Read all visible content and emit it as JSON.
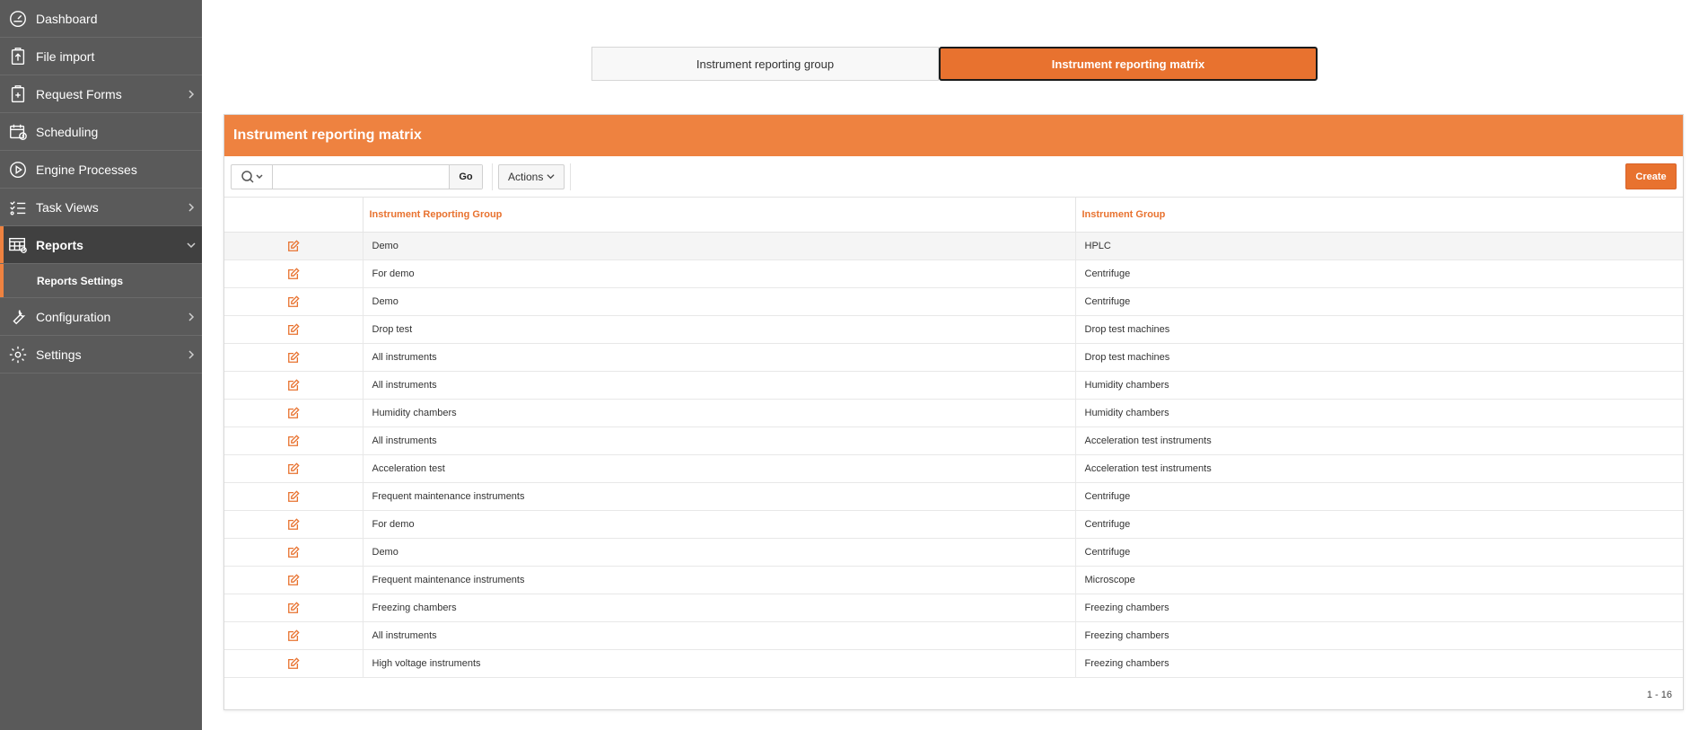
{
  "sidebar": {
    "items": [
      {
        "label": "Dashboard",
        "icon": "dashboard-icon",
        "chevron": false
      },
      {
        "label": "File import",
        "icon": "file-import-icon",
        "chevron": false
      },
      {
        "label": "Request Forms",
        "icon": "request-forms-icon",
        "chevron": true
      },
      {
        "label": "Scheduling",
        "icon": "scheduling-icon",
        "chevron": false
      },
      {
        "label": "Engine Processes",
        "icon": "play-circle-icon",
        "chevron": false
      },
      {
        "label": "Task Views",
        "icon": "task-list-icon",
        "chevron": true
      },
      {
        "label": "Reports",
        "icon": "reports-icon",
        "chevron": true,
        "active": true
      },
      {
        "label": "Configuration",
        "icon": "wrench-icon",
        "chevron": true
      },
      {
        "label": "Settings",
        "icon": "gear-icon",
        "chevron": true
      }
    ],
    "sub_item": "Reports Settings"
  },
  "tabs": {
    "group": "Instrument reporting group",
    "matrix": "Instrument reporting matrix"
  },
  "panel": {
    "title": "Instrument reporting matrix",
    "search_placeholder": "",
    "go_label": "Go",
    "actions_label": "Actions",
    "create_label": "Create"
  },
  "table": {
    "headers": [
      "Instrument Reporting Group",
      "Instrument Group"
    ],
    "rows": [
      [
        "Demo",
        "HPLC"
      ],
      [
        "For demo",
        "Centrifuge"
      ],
      [
        "Demo",
        "Centrifuge"
      ],
      [
        "Drop test",
        "Drop test machines"
      ],
      [
        "All instruments",
        "Drop test machines"
      ],
      [
        "All instruments",
        "Humidity chambers"
      ],
      [
        "Humidity chambers",
        "Humidity chambers"
      ],
      [
        "All instruments",
        "Acceleration test instruments"
      ],
      [
        "Acceleration test",
        "Acceleration test instruments"
      ],
      [
        "Frequent maintenance instruments",
        "Centrifuge"
      ],
      [
        "For demo",
        "Centrifuge"
      ],
      [
        "Demo",
        "Centrifuge"
      ],
      [
        "Frequent maintenance instruments",
        "Microscope"
      ],
      [
        "Freezing chambers",
        "Freezing chambers"
      ],
      [
        "All instruments",
        "Freezing chambers"
      ],
      [
        "High voltage instruments",
        "Freezing chambers"
      ]
    ]
  },
  "pagination": "1 - 16",
  "colors": {
    "accent": "#ee8240",
    "accent_dark": "#e8722f",
    "sidebar": "#5a5a5a"
  }
}
